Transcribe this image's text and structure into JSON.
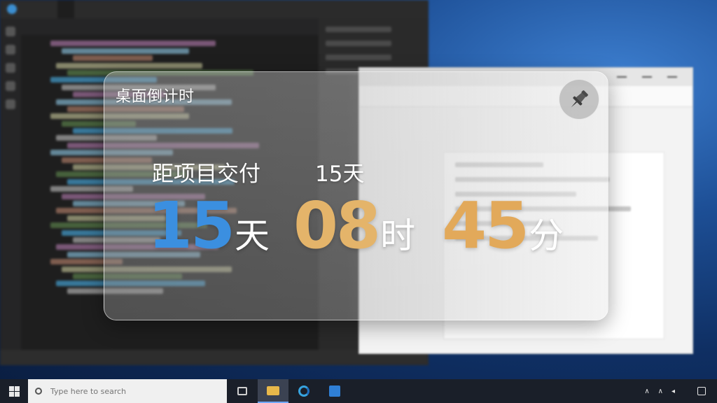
{
  "widget": {
    "title": "桌面倒计时",
    "subtitle_label": "距项目交付",
    "subtitle_days": "15天",
    "countdown": {
      "days": "15",
      "days_unit": "天",
      "hours": "08",
      "hours_unit": "时",
      "minutes": "45",
      "minutes_unit": "分"
    },
    "pin_icon": "pushpin-icon"
  },
  "colors": {
    "days": "#3b8fe0",
    "hours": "#e4b46a",
    "minutes": "#e2a95a"
  },
  "taskbar": {
    "search_placeholder": "Type here to search"
  }
}
